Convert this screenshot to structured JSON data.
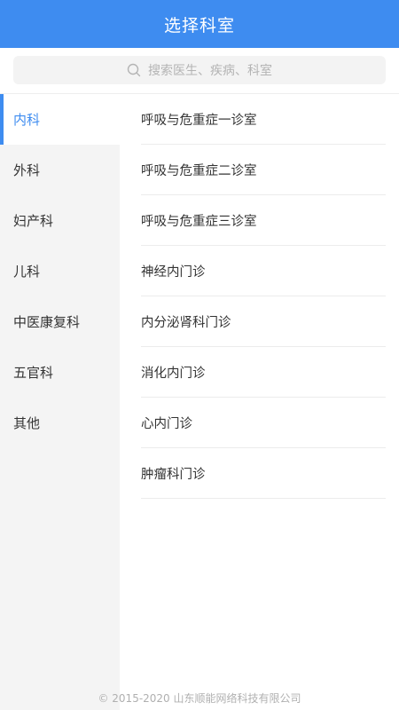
{
  "header": {
    "title": "选择科室"
  },
  "search": {
    "placeholder": "搜索医生、疾病、科室"
  },
  "sidebar": {
    "items": [
      {
        "label": "内科",
        "active": true
      },
      {
        "label": "外科",
        "active": false
      },
      {
        "label": "妇产科",
        "active": false
      },
      {
        "label": "儿科",
        "active": false
      },
      {
        "label": "中医康复科",
        "active": false
      },
      {
        "label": "五官科",
        "active": false
      },
      {
        "label": "其他",
        "active": false
      }
    ]
  },
  "departments": [
    "呼吸与危重症一诊室",
    "呼吸与危重症二诊室",
    "呼吸与危重症三诊室",
    "神经内门诊",
    "内分泌肾科门诊",
    "消化内门诊",
    "心内门诊",
    "肿瘤科门诊"
  ],
  "footer": {
    "copyright": "© 2015-2020 山东顺能网络科技有限公司"
  },
  "colors": {
    "accent": "#3e8cf0",
    "sidebar_bg": "#f4f4f4",
    "text": "#333333"
  },
  "icons": {
    "search": "search-icon"
  }
}
